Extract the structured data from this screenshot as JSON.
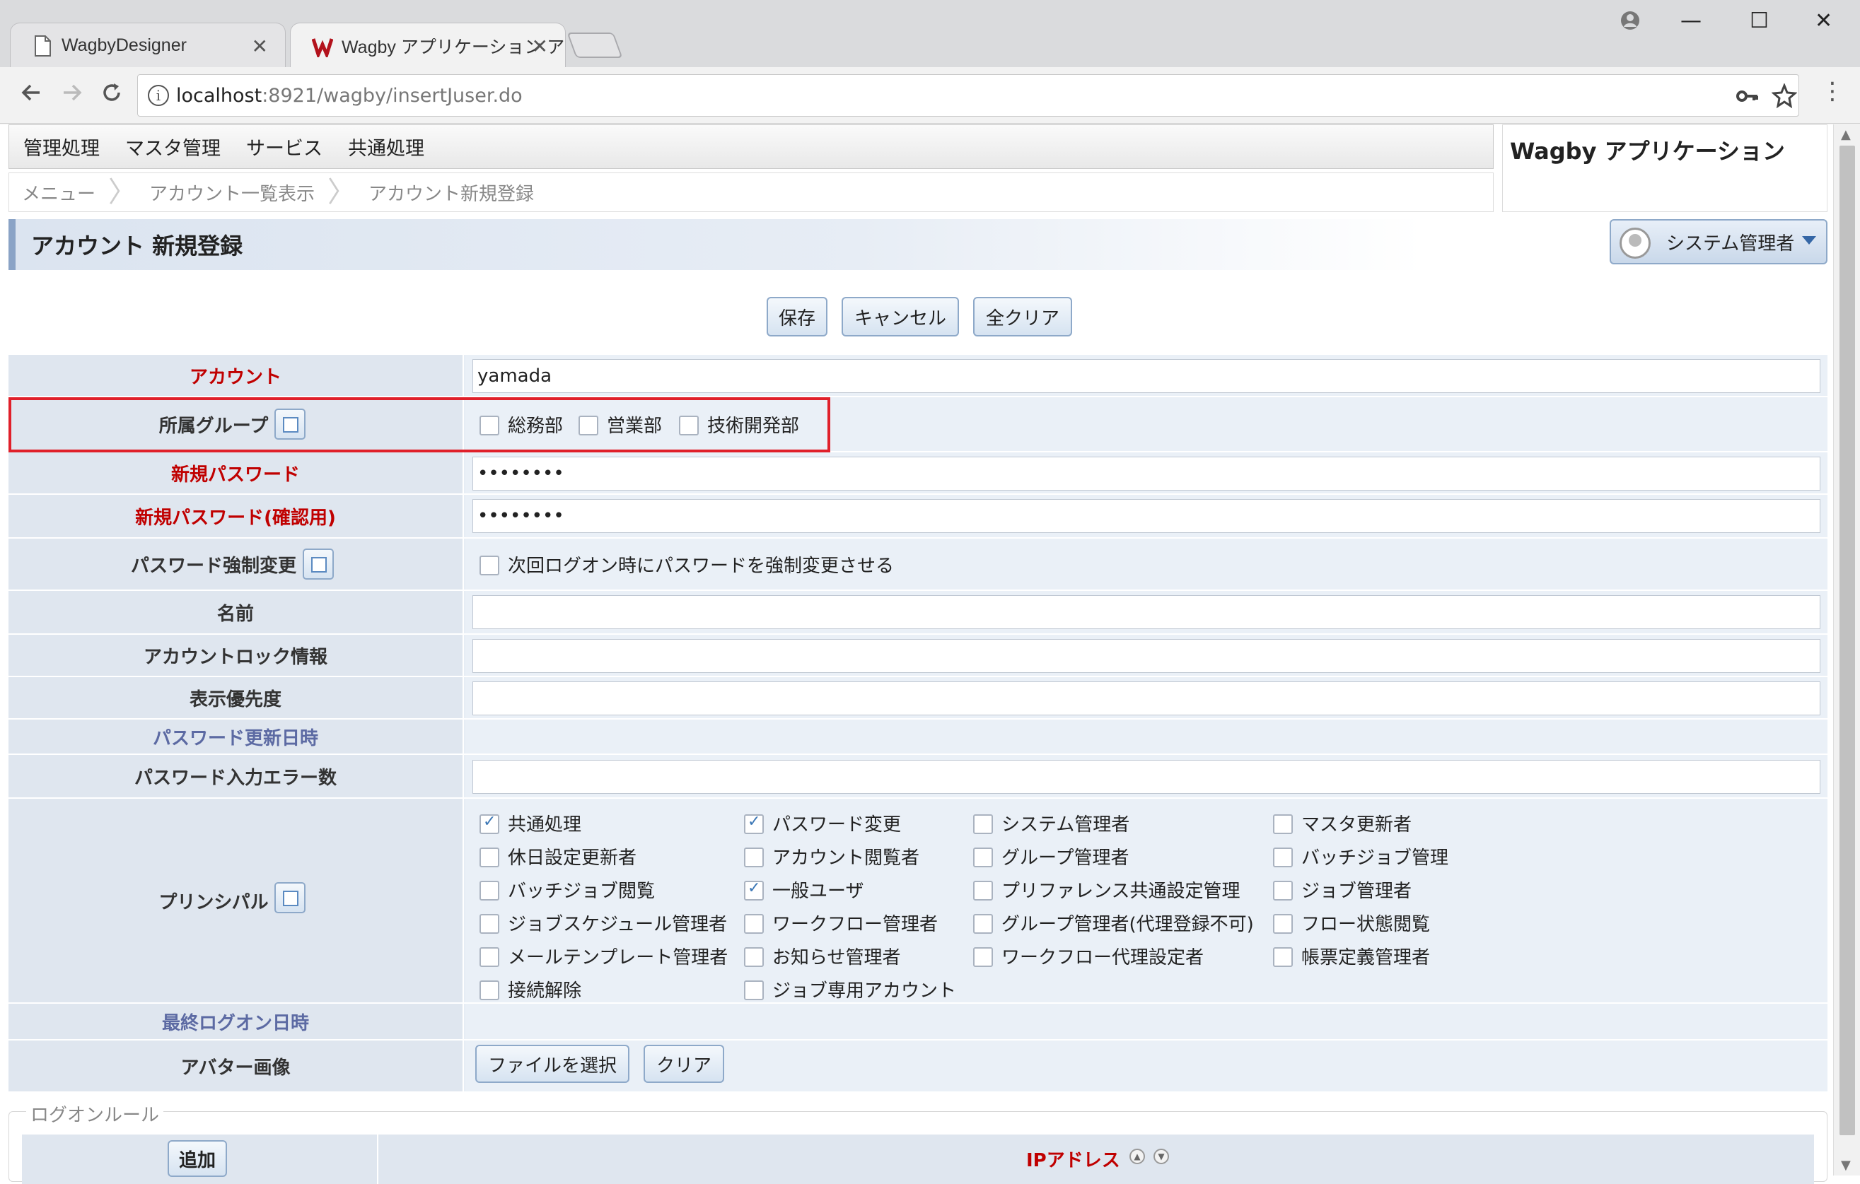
{
  "browser": {
    "tabs": [
      {
        "title": "WagbyDesigner"
      },
      {
        "title": "Wagby アプリケーション ア"
      }
    ],
    "tab_close": "✕",
    "url_host": "localhost",
    "url_path": ":8921/wagby/insertJuser.do",
    "window_controls": {
      "minimize": "—",
      "maximize": "☐",
      "close": "✕"
    }
  },
  "app": {
    "menu": [
      "管理処理",
      "マスタ管理",
      "サービス",
      "共通処理"
    ],
    "breadcrumb": [
      "メニュー",
      "アカウント一覧表示",
      "アカウント新規登録"
    ],
    "app_title": "Wagby アプリケーション",
    "page_title": "アカウント 新規登録",
    "user": "システム管理者"
  },
  "actions": {
    "save": "保存",
    "cancel": "キャンセル",
    "clear_all": "全クリア"
  },
  "form": {
    "account": {
      "label": "アカウント",
      "value": "yamada"
    },
    "group": {
      "label": "所属グループ",
      "options": [
        "総務部",
        "営業部",
        "技術開発部"
      ]
    },
    "new_password": {
      "label": "新規パスワード",
      "value": "••••••••"
    },
    "new_password_confirm": {
      "label": "新規パスワード(確認用)",
      "value": "••••••••"
    },
    "force_change": {
      "label": "パスワード強制変更",
      "option": "次回ログオン時にパスワードを強制変更させる"
    },
    "name": {
      "label": "名前",
      "value": ""
    },
    "lock_info": {
      "label": "アカウントロック情報",
      "value": ""
    },
    "display_priority": {
      "label": "表示優先度",
      "value": ""
    },
    "password_updated": {
      "label": "パスワード更新日時"
    },
    "password_errors": {
      "label": "パスワード入力エラー数",
      "value": ""
    },
    "principal": {
      "label": "プリンシパル",
      "items": [
        {
          "label": "共通処理",
          "checked": true
        },
        {
          "label": "パスワード変更",
          "checked": true
        },
        {
          "label": "システム管理者",
          "checked": false
        },
        {
          "label": "マスタ更新者",
          "checked": false
        },
        {
          "label": "休日設定更新者",
          "checked": false
        },
        {
          "label": "アカウント閲覧者",
          "checked": false
        },
        {
          "label": "グループ管理者",
          "checked": false
        },
        {
          "label": "バッチジョブ管理",
          "checked": false
        },
        {
          "label": "バッチジョブ閲覧",
          "checked": false
        },
        {
          "label": "一般ユーザ",
          "checked": true
        },
        {
          "label": "プリファレンス共通設定管理",
          "checked": false
        },
        {
          "label": "ジョブ管理者",
          "checked": false
        },
        {
          "label": "ジョブスケジュール管理者",
          "checked": false
        },
        {
          "label": "ワークフロー管理者",
          "checked": false
        },
        {
          "label": "グループ管理者(代理登録不可)",
          "checked": false
        },
        {
          "label": "フロー状態閲覧",
          "checked": false
        },
        {
          "label": "メールテンプレート管理者",
          "checked": false
        },
        {
          "label": "お知らせ管理者",
          "checked": false
        },
        {
          "label": "ワークフロー代理設定者",
          "checked": false
        },
        {
          "label": "帳票定義管理者",
          "checked": false
        },
        {
          "label": "接続解除",
          "checked": false
        },
        {
          "label": "ジョブ専用アカウント",
          "checked": false
        }
      ]
    },
    "last_logon": {
      "label": "最終ログオン日時"
    },
    "avatar": {
      "label": "アバター画像",
      "choose_file": "ファイルを選択",
      "clear": "クリア"
    }
  },
  "logon_rule": {
    "legend": "ログオンルール",
    "add": "追加",
    "ip_column": "IPアドレス"
  }
}
